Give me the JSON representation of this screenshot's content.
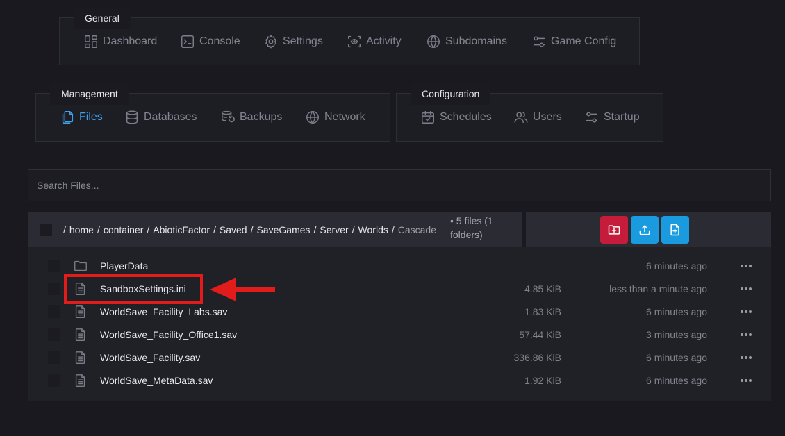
{
  "nav": {
    "general": {
      "label": "General",
      "items": [
        "Dashboard",
        "Console",
        "Settings",
        "Activity",
        "Subdomains",
        "Game Config"
      ]
    },
    "management": {
      "label": "Management",
      "items": [
        "Files",
        "Databases",
        "Backups",
        "Network"
      ],
      "active": "Files"
    },
    "configuration": {
      "label": "Configuration",
      "items": [
        "Schedules",
        "Users",
        "Startup"
      ]
    }
  },
  "search": {
    "placeholder": "Search Files..."
  },
  "breadcrumb": {
    "segments": [
      "home",
      "container",
      "AbioticFactor",
      "Saved",
      "SaveGames",
      "Server",
      "Worlds",
      "Cascade"
    ],
    "count_line1": "• 5 files (1",
    "count_line2": "folders)"
  },
  "actions": {
    "new_folder_icon": "folder-plus-icon",
    "upload_icon": "upload-icon",
    "new_file_icon": "file-plus-icon",
    "colors": {
      "new_folder": "#c41c3a",
      "upload": "#1a9be0",
      "new_file": "#1a9be0"
    }
  },
  "files": [
    {
      "name": "PlayerData",
      "type": "folder",
      "size": "",
      "modified": "6 minutes ago"
    },
    {
      "name": "SandboxSettings.ini",
      "type": "file",
      "size": "4.85 KiB",
      "modified": "less than a minute ago"
    },
    {
      "name": "WorldSave_Facility_Labs.sav",
      "type": "file",
      "size": "1.83 KiB",
      "modified": "6 minutes ago"
    },
    {
      "name": "WorldSave_Facility_Office1.sav",
      "type": "file",
      "size": "57.44 KiB",
      "modified": "3 minutes ago"
    },
    {
      "name": "WorldSave_Facility.sav",
      "type": "file",
      "size": "336.86 KiB",
      "modified": "6 minutes ago"
    },
    {
      "name": "WorldSave_MetaData.sav",
      "type": "file",
      "size": "1.92 KiB",
      "modified": "6 minutes ago"
    }
  ],
  "annotation": {
    "highlight_color": "#e21b1b",
    "highlighted_file": "SandboxSettings.ini"
  }
}
